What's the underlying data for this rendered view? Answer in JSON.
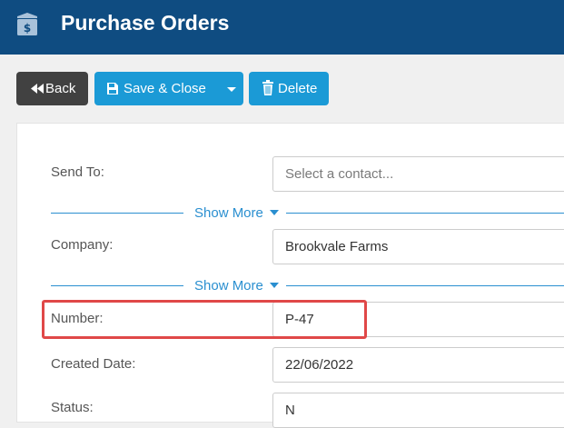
{
  "header": {
    "title": "Purchase Orders",
    "icon": "money-box-icon",
    "background": "#0f4c81"
  },
  "toolbar": {
    "back_label": "Back",
    "save_close_label": "Save & Close",
    "delete_label": "Delete",
    "primary_color": "#1b9ad6",
    "back_color": "#414141"
  },
  "form": {
    "send_to": {
      "label": "Send To:",
      "placeholder": "Select a contact..."
    },
    "show_more_1": "Show More",
    "company": {
      "label": "Company:",
      "value": "Brookvale Farms"
    },
    "show_more_2": "Show More",
    "number": {
      "label": "Number:",
      "value": "P-47"
    },
    "created_date": {
      "label": "Created Date:",
      "value": "22/06/2022"
    },
    "status": {
      "label": "Status:",
      "value": "N"
    }
  },
  "highlight_color": "#e04848"
}
